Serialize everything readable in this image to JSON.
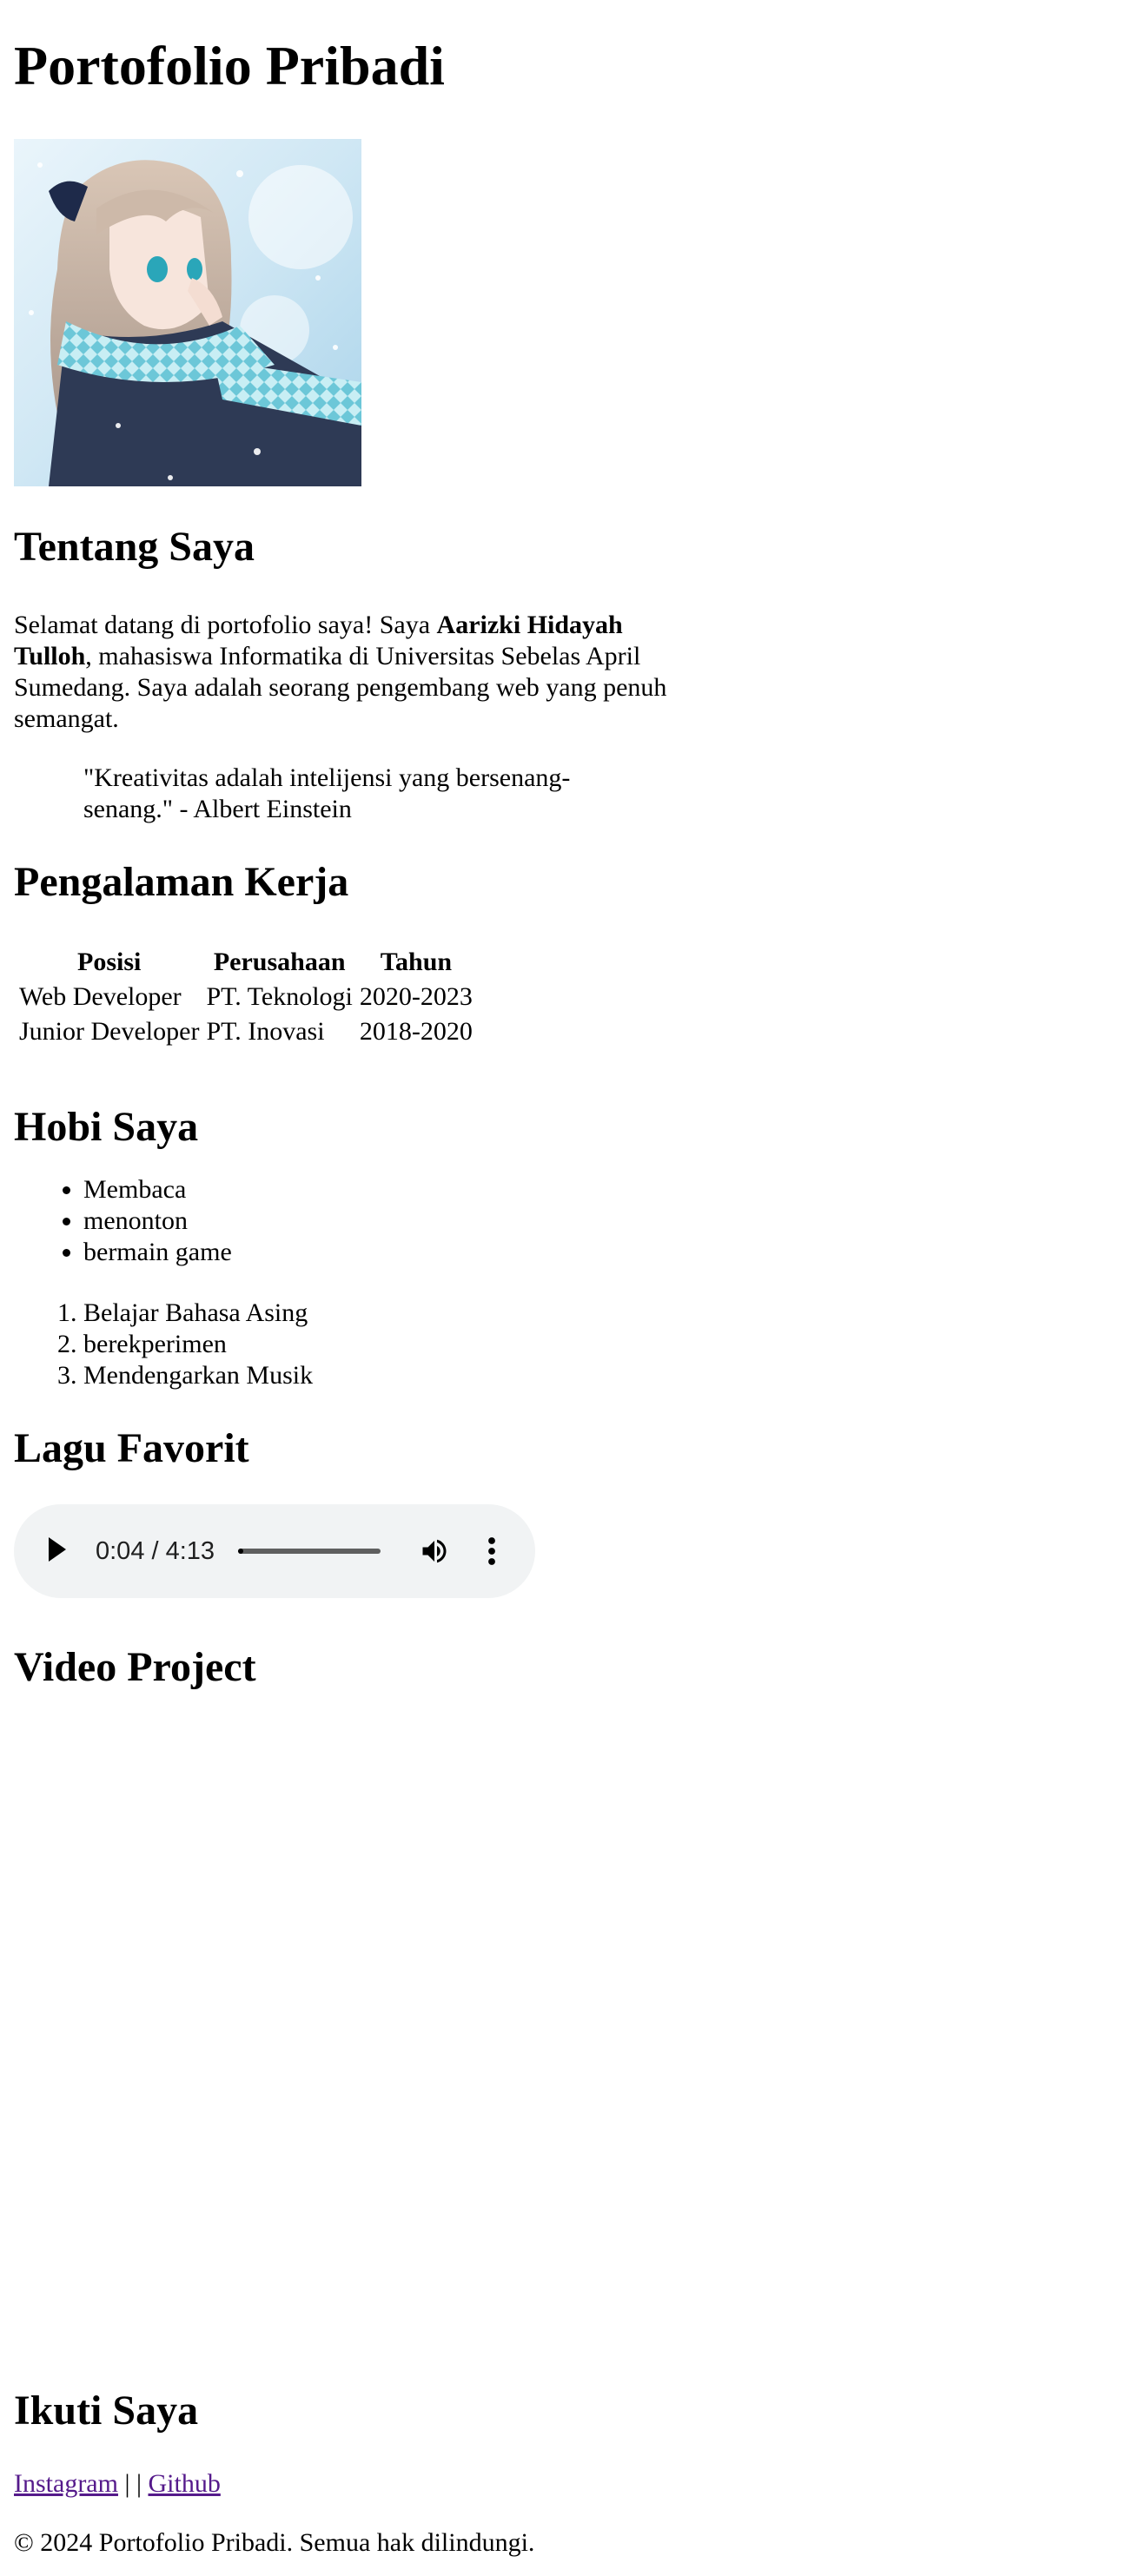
{
  "page": {
    "title": "Portofolio Pribadi"
  },
  "about": {
    "heading": "Tentang Saya",
    "intro": "Selamat datang di portofolio saya! Saya ",
    "name": "Aarizki Hidayah Tulloh",
    "rest": ", mahasiswa Informatika di Universitas Sebelas April Sumedang. Saya adalah seorang pengembang web yang penuh semangat.",
    "quote": "\"Kreativitas adalah intelijensi yang bersenang-senang.\" - Albert Einstein"
  },
  "experience": {
    "heading": "Pengalaman Kerja",
    "columns": [
      "Posisi",
      "Perusahaan",
      "Tahun"
    ],
    "rows": [
      [
        "Web Developer",
        "PT. Teknologi",
        "2020-2023"
      ],
      [
        "Junior Developer",
        "PT. Inovasi",
        "2018-2020"
      ]
    ]
  },
  "hobbies": {
    "heading": "Hobi Saya",
    "bullets": [
      "Membaca",
      "menonton",
      "bermain game"
    ],
    "numbered": [
      "Belajar Bahasa Asing",
      "berekperimen",
      "Mendengarkan Musik"
    ]
  },
  "music": {
    "heading": "Lagu Favorit",
    "time": "0:04 / 4:13",
    "progress_fraction": 0.016
  },
  "video": {
    "heading": "Video Project"
  },
  "social": {
    "heading": "Ikuti Saya",
    "instagram": "Instagram",
    "separator": " | | ",
    "github": "Github"
  },
  "footer": {
    "text": "© 2024 Portofolio Pribadi. Semua hak dilindungi."
  },
  "icons": {
    "play": "play-icon",
    "volume": "volume-icon",
    "menu": "more-vertical-icon"
  },
  "colors": {
    "player_bg": "#f1f3f4",
    "link_visited": "#551a8b",
    "text": "#000000"
  }
}
